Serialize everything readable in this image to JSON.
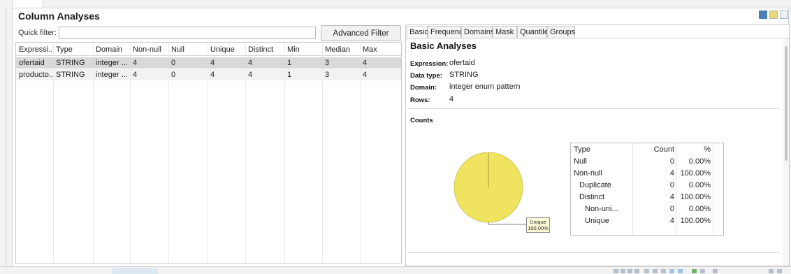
{
  "header": {
    "title": "Column Analyses"
  },
  "filter": {
    "label": "Quick filter:",
    "value": "",
    "placeholder": "",
    "advanced_button": "Advanced Filter"
  },
  "table": {
    "columns": [
      "Expressi...",
      "Type",
      "Domain",
      "Non-null",
      "Null",
      "Unique",
      "Distinct",
      "Min",
      "Median",
      "Max"
    ],
    "rows": [
      [
        "ofertaid",
        "STRING",
        "integer ...",
        "4",
        "0",
        "4",
        "4",
        "1",
        "3",
        "4"
      ],
      [
        "producto...",
        "STRING",
        "integer ...",
        "4",
        "0",
        "4",
        "4",
        "1",
        "3",
        "4"
      ]
    ]
  },
  "panel": {
    "tabs": [
      "Basic",
      "Frequency",
      "Domains",
      "Mask",
      "Quantiles",
      "Groups"
    ],
    "active_tab": "Basic",
    "title": "Basic Analyses",
    "expression_label": "Expression:",
    "expression_value": "ofertaid",
    "datatype_label": "Data type:",
    "datatype_value": "STRING",
    "domain_label": "Domain:",
    "domain_value": "integer enum pattern",
    "rows_label": "Rows:",
    "rows_value": "4",
    "counts_title": "Counts"
  },
  "counts_table": {
    "headers": [
      "Type",
      "Count",
      "%"
    ],
    "rows": [
      {
        "type": "Null",
        "count": "0",
        "pct": "0.00%",
        "indent": 0
      },
      {
        "type": "Non-null",
        "count": "4",
        "pct": "100.00%",
        "indent": 0
      },
      {
        "type": "Duplicate",
        "count": "0",
        "pct": "0.00%",
        "indent": 1
      },
      {
        "type": "Distinct",
        "count": "4",
        "pct": "100.00%",
        "indent": 1
      },
      {
        "type": "Non-uni...",
        "count": "0",
        "pct": "0.00%",
        "indent": 2
      },
      {
        "type": "Unique",
        "count": "4",
        "pct": "100.00%",
        "indent": 2
      }
    ]
  },
  "pie": {
    "label_line1": "Unique",
    "label_line2": "100.00%",
    "slice_fraction": 1.0,
    "color": "#f0e35f",
    "edge_color": "#c8bd45"
  },
  "icons": {
    "header": [
      "chart-icon",
      "grid-view-icon",
      "list-view-icon"
    ]
  },
  "colors": {
    "selected_row": "#d9d9d9",
    "alt_row": "#f2f2f2",
    "pie_fill": "#f0e35f"
  }
}
